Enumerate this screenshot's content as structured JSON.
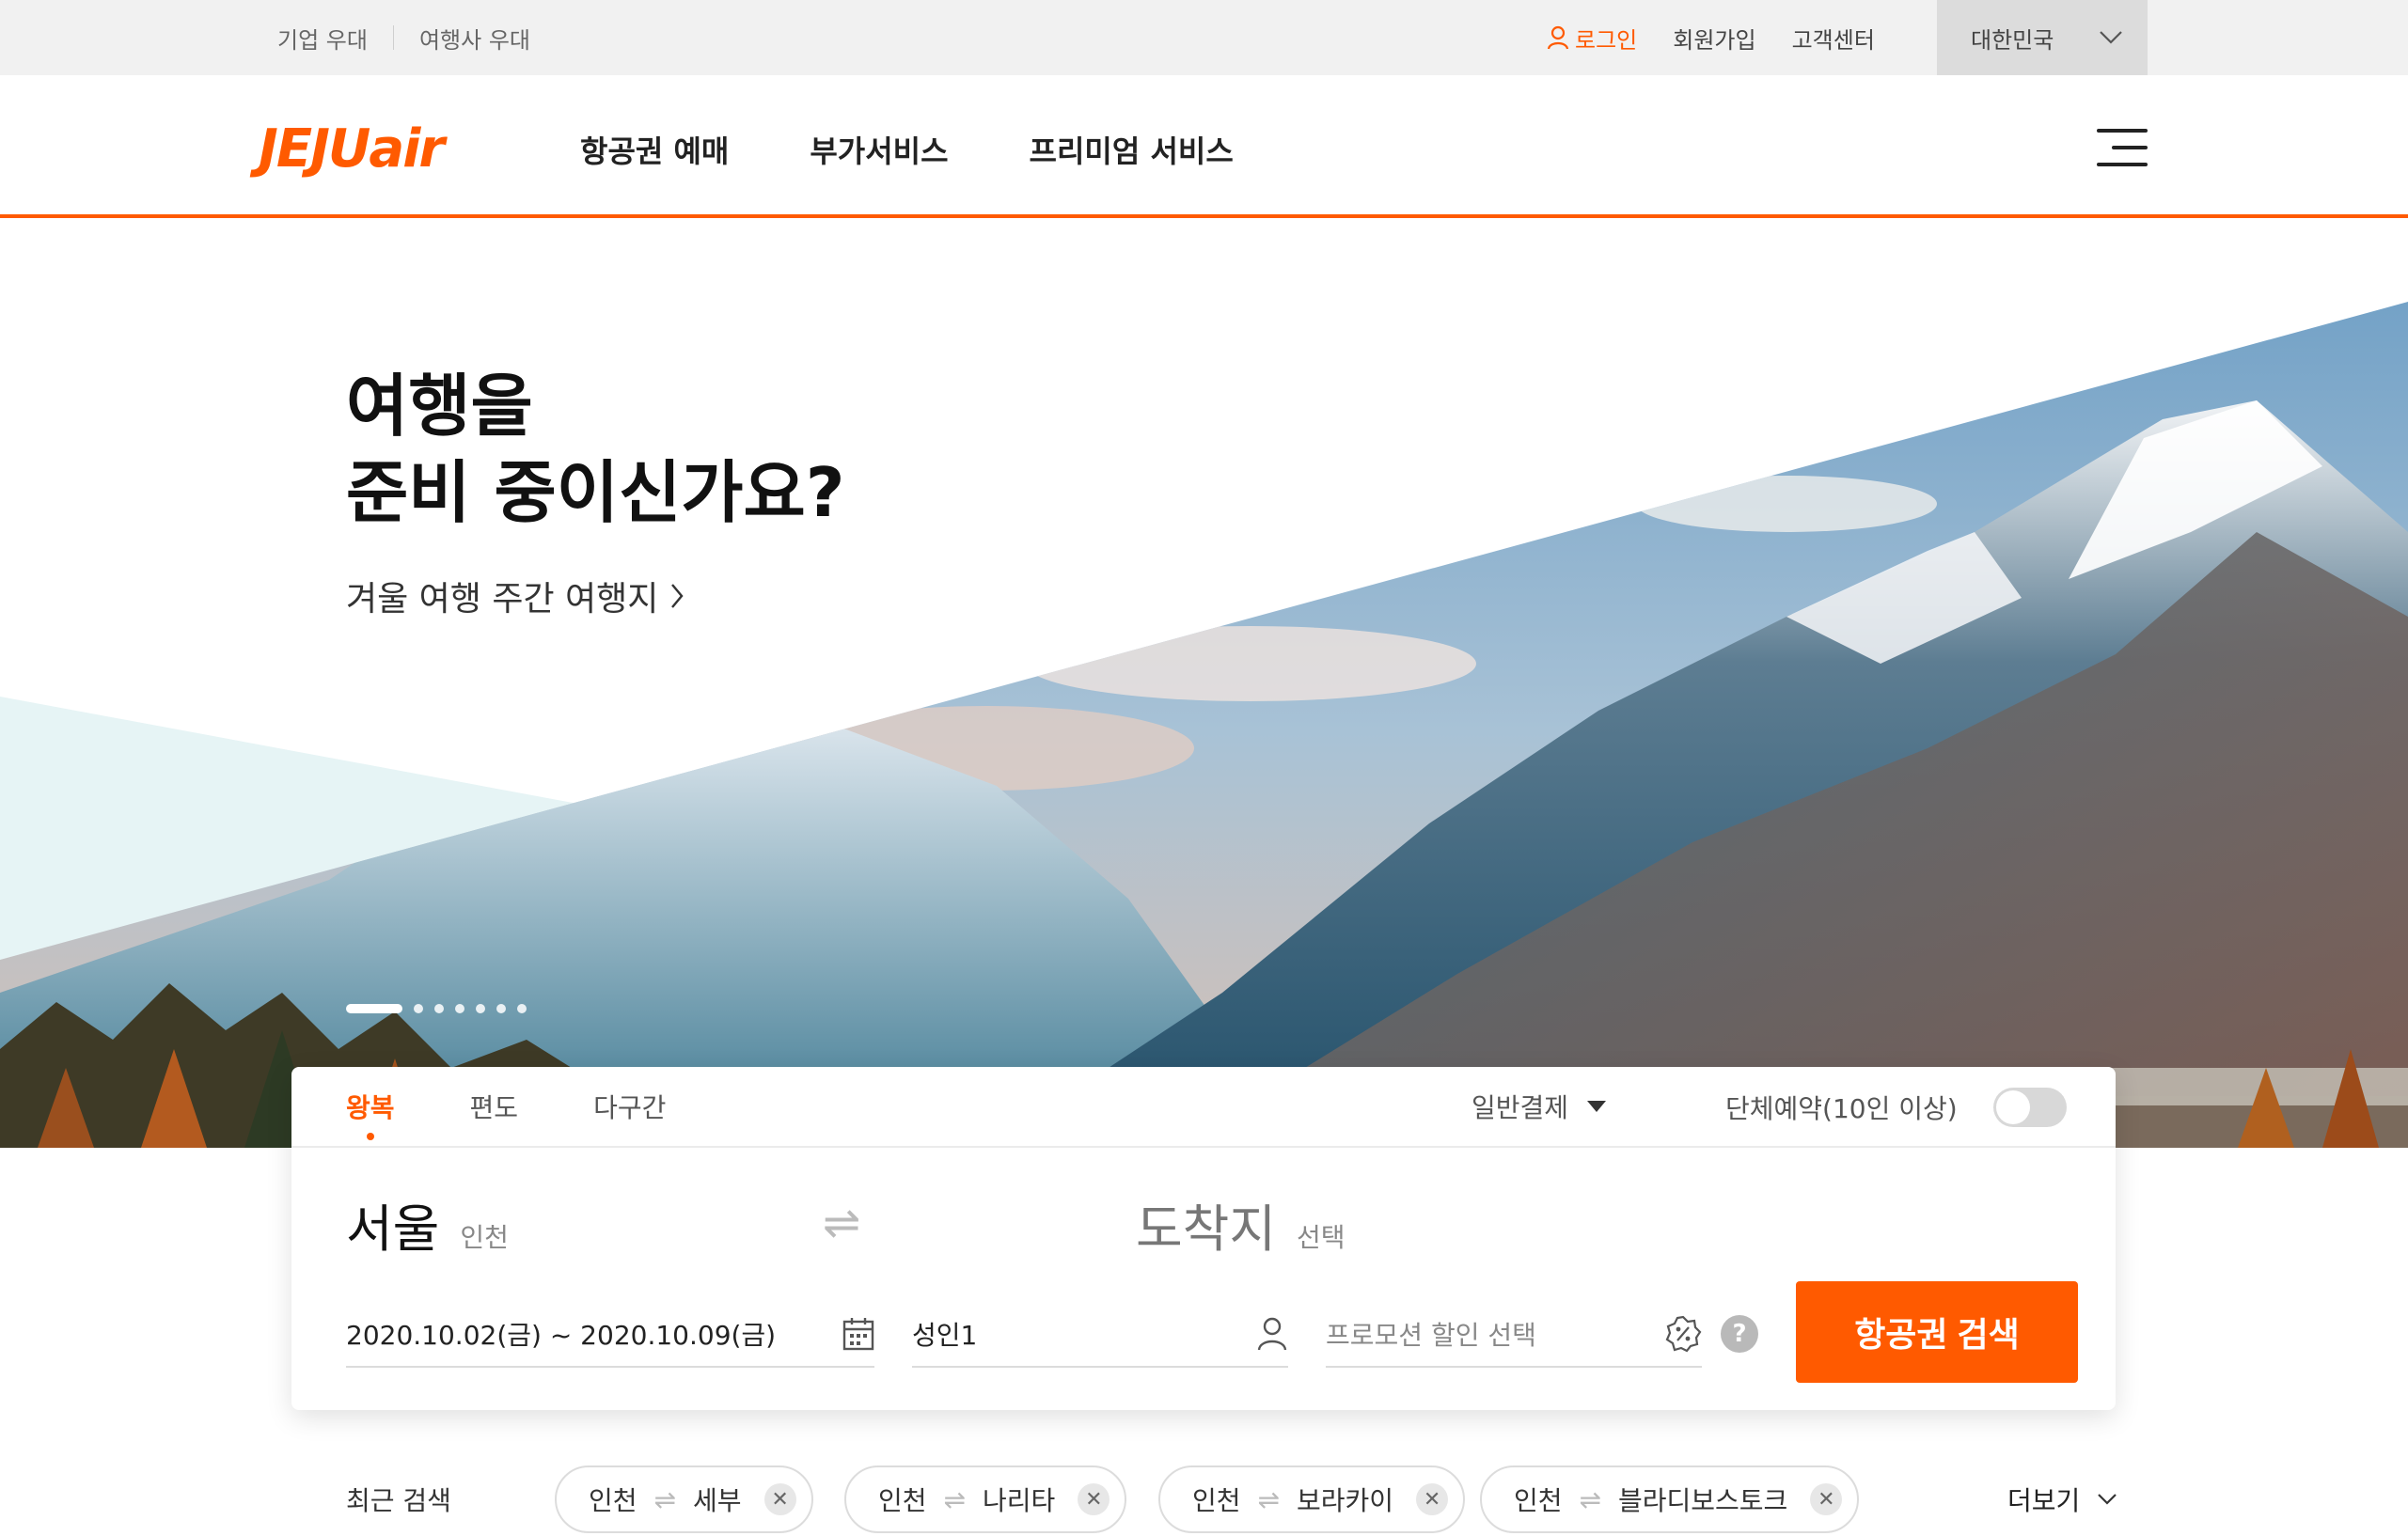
{
  "topbar": {
    "corporate_label": "기업 우대",
    "agency_label": "여행사 우대",
    "login_label": "로그인",
    "join_label": "회원가입",
    "support_label": "고객센터",
    "country_label": "대한민국"
  },
  "header": {
    "logo_text": "JEJUair",
    "nav": [
      "항공권 예매",
      "부가서비스",
      "프리미엄 서비스"
    ]
  },
  "hero": {
    "title_line1": "여행을",
    "title_line2": "준비 중이신가요?",
    "link_label": "겨울 여행 주간 여행지",
    "slide_count": 7,
    "active_slide": 1
  },
  "booking": {
    "tabs": [
      "왕복",
      "편도",
      "다구간"
    ],
    "active_tab": "왕복",
    "payment_type": "일반결제",
    "group_label": "단체예약(10인 이상)",
    "group_enabled": false,
    "origin_city": "서울",
    "origin_airport": "인천",
    "destination_city": "도착지",
    "destination_hint": "선택",
    "dates": "2020.10.02(금) ~ 2020.10.09(금)",
    "passengers": "성인1",
    "promo_placeholder": "프로모션 할인 선택",
    "help_label": "?",
    "search_label": "항공권 검색"
  },
  "recent": {
    "label": "최근 검색",
    "items": [
      {
        "from": "인천",
        "to": "세부"
      },
      {
        "from": "인천",
        "to": "나리타"
      },
      {
        "from": "인천",
        "to": "보라카이"
      },
      {
        "from": "인천",
        "to": "블라디보스토크"
      }
    ],
    "more_label": "더보기"
  },
  "colors": {
    "brand": "#ff5a00",
    "topbar_bg": "#f1f1f1"
  }
}
